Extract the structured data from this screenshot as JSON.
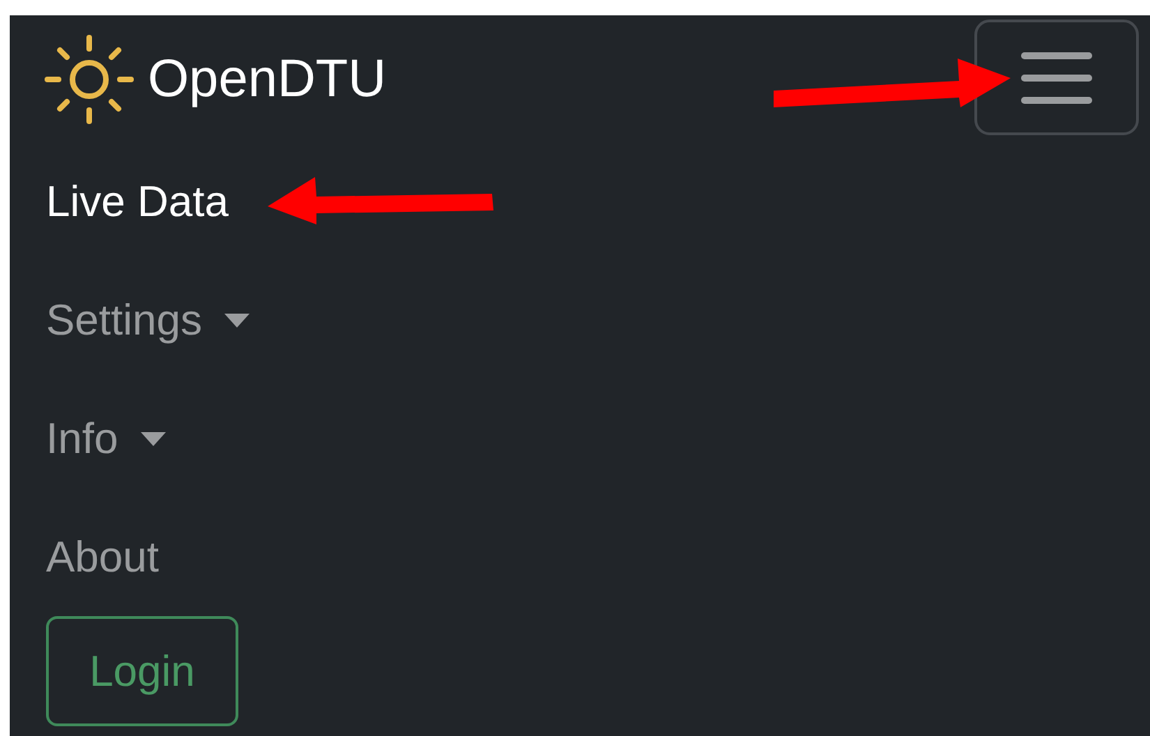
{
  "navbar": {
    "brand": "OpenDTU",
    "toggler": {
      "expanded": true
    }
  },
  "nav_items": [
    {
      "label": "Live Data",
      "selected": true,
      "dropdown": false
    },
    {
      "label": "Settings",
      "selected": false,
      "dropdown": true
    },
    {
      "label": "Info",
      "selected": false,
      "dropdown": true
    },
    {
      "label": "About",
      "selected": false,
      "dropdown": false
    }
  ],
  "login_button": {
    "label": "Login"
  }
}
